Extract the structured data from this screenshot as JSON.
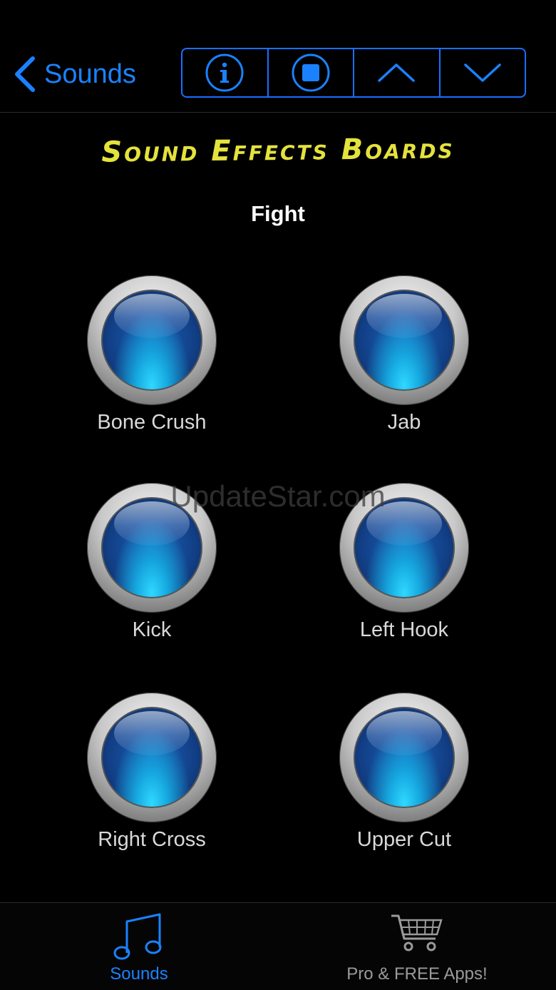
{
  "nav": {
    "back_label": "Sounds",
    "segments": [
      {
        "icon": "info-icon"
      },
      {
        "icon": "stop-icon"
      },
      {
        "icon": "chevron-up-icon"
      },
      {
        "icon": "chevron-down-icon"
      }
    ]
  },
  "app_title": "Sound Effects Boards",
  "board_title": "Fight",
  "sounds": [
    {
      "label": "Bone Crush"
    },
    {
      "label": "Jab"
    },
    {
      "label": "Kick"
    },
    {
      "label": "Left Hook"
    },
    {
      "label": "Right Cross"
    },
    {
      "label": "Upper Cut"
    }
  ],
  "watermark": "UpdateStar.com",
  "tabs": [
    {
      "label": "Sounds",
      "icon": "music-note-icon",
      "active": true
    },
    {
      "label": "Pro & FREE Apps!",
      "icon": "shopping-cart-icon",
      "active": false
    }
  ],
  "colors": {
    "accent": "#1a82ff",
    "title": "#e4e23c",
    "inactive_tab": "#9a9a9a"
  }
}
